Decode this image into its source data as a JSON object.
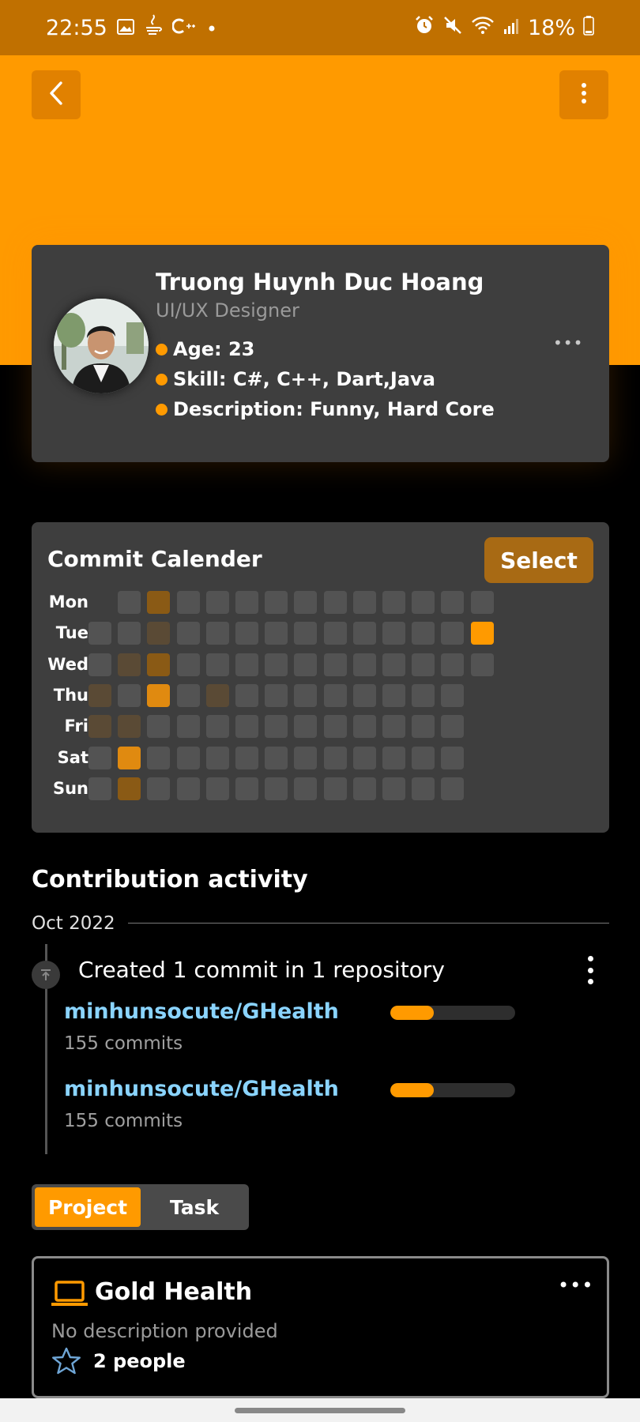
{
  "status_bar": {
    "time": "22:55",
    "battery": "18%",
    "left_icons": [
      "gallery-icon",
      "java-icon",
      "cplusplus-icon",
      "dot-icon"
    ],
    "right_icons": [
      "alarm-icon",
      "mute-icon",
      "wifi-icon",
      "signal-icon",
      "battery-icon"
    ]
  },
  "header": {
    "back_icon": "chevron-left-icon",
    "menu_icon": "more-vertical-icon",
    "accent_color": "#ff9a00"
  },
  "profile": {
    "name": "Truong Huynh Duc Hoang",
    "role": "UI/UX Designer",
    "age": "Age: 23",
    "skill": "Skill: C#, C++, Dart,Java",
    "description": "Description: Funny, Hard Core",
    "more": "•••"
  },
  "commit_calendar": {
    "title": "Commit Calender",
    "select_label": "Select",
    "days": [
      "Mon",
      "Tue",
      "Wed",
      "Thu",
      "Fri",
      "Sat",
      "Sun"
    ],
    "colors": [
      "#535353",
      "#5a4a35",
      "#8a5a15",
      "#e08a10",
      "#ff9a00"
    ],
    "weeks": [
      [
        null,
        0,
        0,
        1,
        1,
        0,
        0
      ],
      [
        0,
        0,
        1,
        0,
        1,
        3,
        2
      ],
      [
        2,
        1,
        2,
        3,
        0,
        0,
        0
      ],
      [
        0,
        0,
        0,
        0,
        0,
        0,
        0
      ],
      [
        0,
        0,
        0,
        1,
        0,
        0,
        0
      ],
      [
        0,
        0,
        0,
        0,
        0,
        0,
        0
      ],
      [
        0,
        0,
        0,
        0,
        0,
        0,
        0
      ],
      [
        0,
        0,
        0,
        0,
        0,
        0,
        0
      ],
      [
        0,
        0,
        0,
        0,
        0,
        0,
        0
      ],
      [
        0,
        0,
        0,
        0,
        0,
        0,
        0
      ],
      [
        0,
        0,
        0,
        0,
        0,
        0,
        0
      ],
      [
        0,
        0,
        0,
        0,
        0,
        0,
        0
      ],
      [
        0,
        0,
        0,
        0,
        0,
        0,
        0
      ],
      [
        0,
        4,
        0,
        null,
        null,
        null,
        null
      ]
    ]
  },
  "contribution": {
    "title": "Contribution activity",
    "month": "Oct 2022",
    "event_icon": "push-icon",
    "event_text": "Created 1 commit in 1 repository",
    "repos": [
      {
        "name": "minhunsocute/GHealth",
        "commits": "155 commits",
        "progress": 0.35
      },
      {
        "name": "minhunsocute/GHealth",
        "commits": "155 commits",
        "progress": 0.35
      }
    ]
  },
  "tabs": {
    "project": "Project",
    "task": "Task",
    "active": "project"
  },
  "project_card": {
    "icon": "laptop-icon",
    "title": "Gold Health",
    "description": "No description provided",
    "people_icon": "star-icon",
    "people": "2 people",
    "more": "•••"
  }
}
